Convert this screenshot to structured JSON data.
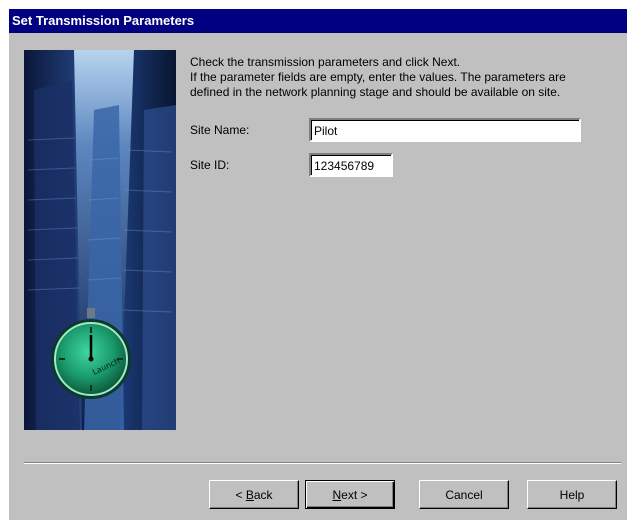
{
  "dialog": {
    "title": "Set Transmission Parameters"
  },
  "instructions": {
    "line1": "Check the transmission parameters and click Next.",
    "line2": "If the parameter fields are empty, enter the values. The parameters are",
    "line3": "defined in the network planning stage and should be available on site."
  },
  "fields": {
    "site_name_label": "Site Name:",
    "site_name_value": "Pilot",
    "site_id_label": "Site ID:",
    "site_id_value": "123456789"
  },
  "image": {
    "clock_text": "Launch"
  },
  "buttons": {
    "back_pre": "< ",
    "back_key": "B",
    "back_post": "ack",
    "next_key": "N",
    "next_post": "ext >",
    "cancel": "Cancel",
    "help": "Help"
  },
  "colors": {
    "title_bar": "#000080",
    "dialog_face": "#c0c0c0",
    "clock_face": "#1a9a6a"
  }
}
